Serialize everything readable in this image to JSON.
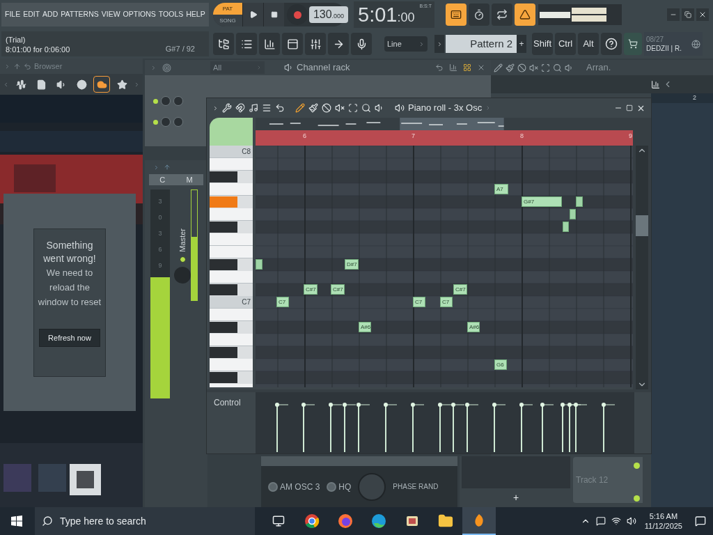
{
  "menu": [
    "FILE",
    "EDIT",
    "ADD",
    "PATTERNS",
    "VIEW",
    "OPTIONS",
    "TOOLS",
    "HELP"
  ],
  "transport": {
    "modes": [
      {
        "label": "PAT",
        "selected": true
      },
      {
        "label": "SONG",
        "selected": false
      }
    ],
    "recording": false,
    "tempo": "130",
    "tempo_decimals": ".000",
    "time": "5:01",
    "time_ticks": ":00",
    "time_format": "B:S:T"
  },
  "toggles": [
    {
      "kind": "typing-keyboard",
      "on": true
    },
    {
      "kind": "countdown",
      "on": false
    },
    {
      "kind": "loop",
      "on": false
    },
    {
      "kind": "metronome",
      "on": true
    }
  ],
  "hint": {
    "line1": "(Trial)",
    "line2": "8:01:00 for 0:06:00",
    "note": "G#7 / 92"
  },
  "snap": {
    "value": "Line"
  },
  "pattern": {
    "name": "Pattern 2",
    "add": "+"
  },
  "modifier_keys": [
    "Shift",
    "Ctrl",
    "Alt"
  ],
  "news": {
    "date": "08/27",
    "title": "DEDZII | R."
  },
  "browser": {
    "title": "Browser",
    "tabs": [
      {
        "kind": "plugin",
        "selected": false
      },
      {
        "kind": "file",
        "selected": false
      },
      {
        "kind": "sound",
        "selected": false
      },
      {
        "kind": "web",
        "selected": false
      },
      {
        "kind": "cloud",
        "selected": true
      },
      {
        "kind": "star",
        "selected": false
      }
    ]
  },
  "error_dialog": {
    "heading": "Something went wrong!",
    "message": "We need to reload the window to reset",
    "button": "Refresh now"
  },
  "channel_rack": {
    "filter": "All",
    "title": "Channel rack"
  },
  "mixer": {
    "headers": [
      "C",
      "M"
    ],
    "scale": [
      "3",
      "0",
      "3",
      "6",
      "9"
    ],
    "track": "Master",
    "level": 0.58
  },
  "piano_roll": {
    "title": "Piano roll - 3x Osc",
    "bars": [
      "6",
      "7",
      "8",
      "9"
    ],
    "keys": [
      {
        "kind": "white",
        "pressed": false,
        "label": "C8"
      },
      {
        "kind": "white",
        "pressed": false
      },
      {
        "kind": "black",
        "pressed": false
      },
      {
        "kind": "white",
        "pressed": false
      },
      {
        "kind": "black",
        "pressed": true
      },
      {
        "kind": "white",
        "pressed": false
      },
      {
        "kind": "black",
        "pressed": false
      },
      {
        "kind": "white",
        "pressed": false
      },
      {
        "kind": "white",
        "pressed": false
      },
      {
        "kind": "black",
        "pressed": false
      },
      {
        "kind": "white",
        "pressed": false
      },
      {
        "kind": "black",
        "pressed": false
      },
      {
        "kind": "white",
        "pressed": false,
        "label": "C7"
      },
      {
        "kind": "white",
        "pressed": false
      },
      {
        "kind": "black",
        "pressed": false
      },
      {
        "kind": "white",
        "pressed": false
      },
      {
        "kind": "black",
        "pressed": false
      },
      {
        "kind": "white",
        "pressed": false
      },
      {
        "kind": "black",
        "pressed": false
      },
      {
        "kind": "white",
        "pressed": false
      }
    ],
    "notes": [
      {
        "kind": "short"
      },
      {
        "kind": "labeled",
        "label": "C7"
      },
      {
        "kind": "labeled",
        "label": "C#7"
      },
      {
        "kind": "labeled",
        "label": "C#7"
      },
      {
        "kind": "labeled",
        "label": "D#7"
      },
      {
        "kind": "labeled",
        "label": "A#6"
      },
      {
        "kind": "labeled",
        "label": "C7"
      },
      {
        "kind": "labeled",
        "label": "C7"
      },
      {
        "kind": "labeled",
        "label": "C#7"
      },
      {
        "kind": "labeled",
        "label": "A#6"
      },
      {
        "kind": "labeled",
        "label": "A7"
      },
      {
        "kind": "labeled",
        "label": "G6"
      },
      {
        "kind": "labeled",
        "label": "G#7"
      },
      {
        "kind": "short"
      },
      {
        "kind": "short"
      },
      {
        "kind": "short"
      }
    ],
    "lane": "Control"
  },
  "plugin": {
    "buttons": [
      {
        "label": "AM OSC 3",
        "on": false
      },
      {
        "label": "HQ",
        "on": false
      }
    ],
    "knob_label": "PHASE RAND"
  },
  "pattern_panel": {
    "add": "+"
  },
  "playlist": {
    "title": "Arran.",
    "bar": "2",
    "track": "Track 12"
  },
  "taskbar": {
    "search_placeholder": "Type here to search",
    "time": "5:16 AM",
    "date": "11/12/2025",
    "apps": [
      {
        "kind": "task-view",
        "active": false
      },
      {
        "kind": "chrome",
        "active": false
      },
      {
        "kind": "firefox",
        "active": false
      },
      {
        "kind": "edge",
        "active": false
      },
      {
        "kind": "app",
        "active": false
      },
      {
        "kind": "folder",
        "active": false
      },
      {
        "kind": "fl",
        "active": true
      }
    ]
  }
}
